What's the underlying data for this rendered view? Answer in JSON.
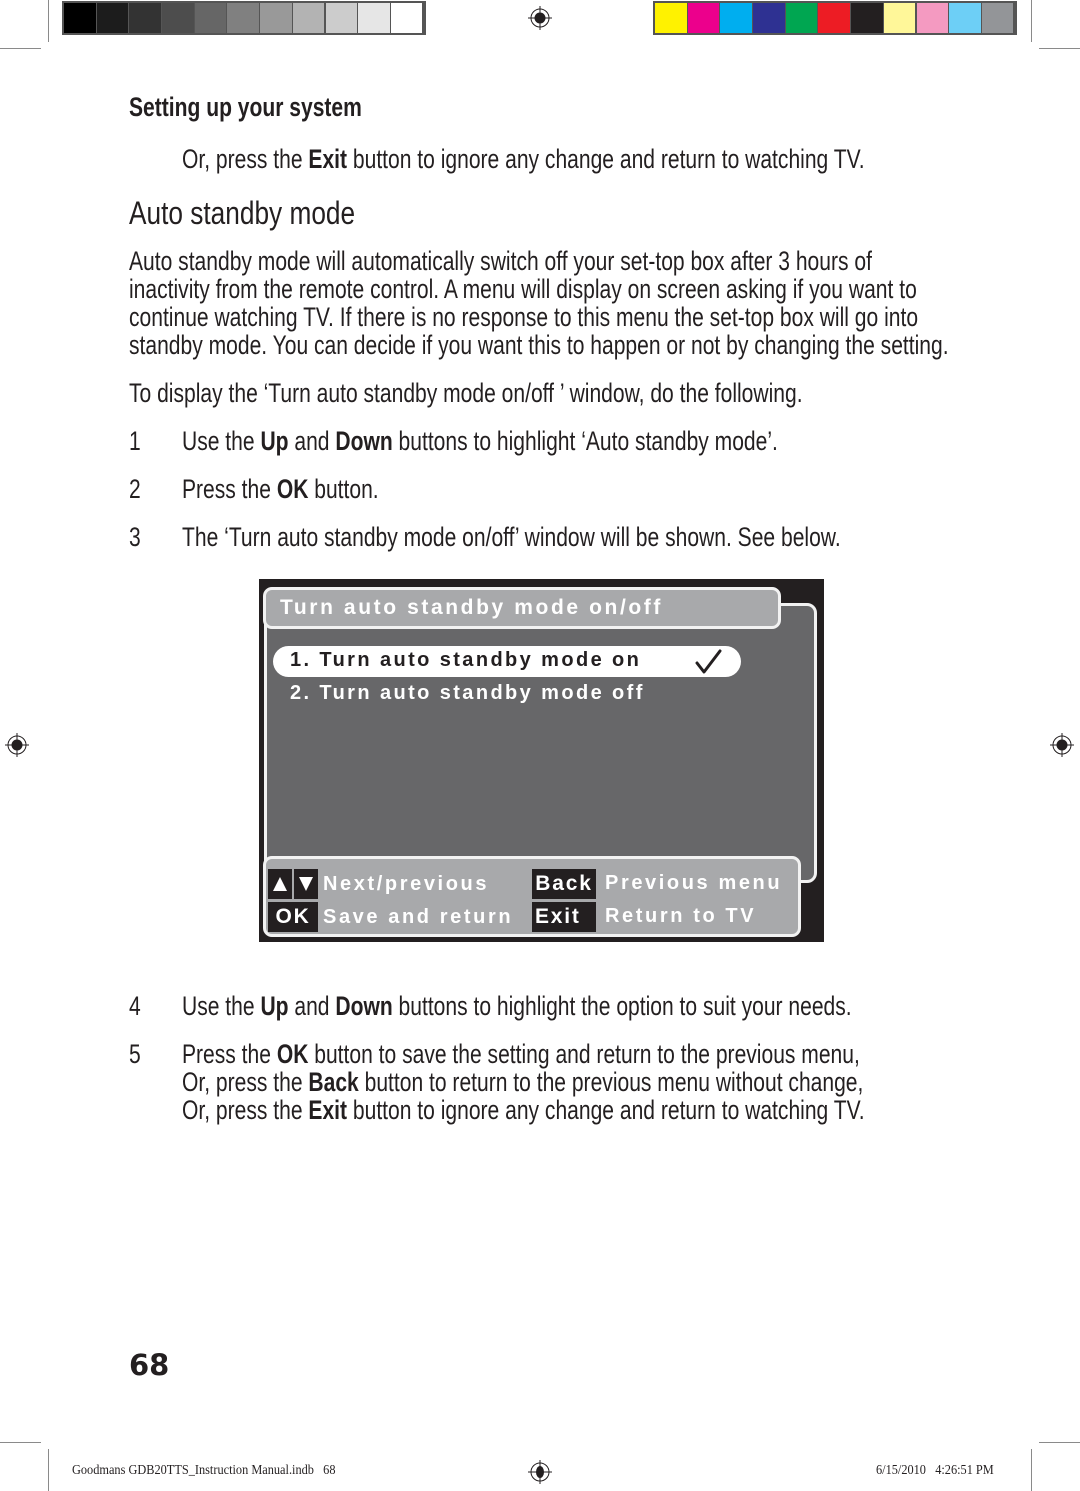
{
  "print_marks": {
    "gray_swatches": [
      "#000000",
      "#1c1c1c",
      "#333333",
      "#4d4d4d",
      "#666666",
      "#808080",
      "#999999",
      "#b3b3b3",
      "#cccccc",
      "#e6e6e6",
      "#ffffff"
    ],
    "color_swatches": [
      "#fff200",
      "#ec008c",
      "#00aeef",
      "#2e3192",
      "#00a651",
      "#ed1c24",
      "#231f20",
      "#fff799",
      "#f49ac1",
      "#6dcff6",
      "#939598"
    ]
  },
  "header": {
    "section_title": "Setting up your system"
  },
  "intro_line": {
    "pre": "Or, press the ",
    "bold": "Exit",
    "post": " button to ignore any change and return to watching TV."
  },
  "heading": "Auto standby mode",
  "paragraph_lines": [
    "Auto standby mode will automatically switch off your set-top box after 3 hours of",
    "inactivity from the remote control. A menu will display on screen asking if you want to",
    "continue watching TV. If there is no response to this menu the set-top box will go into",
    "standby mode. You can decide if you want this to happen or not by changing the setting."
  ],
  "lead_in": "To display the ‘Turn auto standby mode on/off ’ window, do the following.",
  "steps": [
    {
      "num": "1",
      "parts": [
        [
          "Use the ",
          false
        ],
        [
          "Up",
          true
        ],
        [
          " and ",
          false
        ],
        [
          "Down",
          true
        ],
        [
          " buttons to highlight ‘Auto standby mode’.",
          false
        ]
      ]
    },
    {
      "num": "2",
      "parts": [
        [
          "Press the ",
          false
        ],
        [
          "OK",
          true
        ],
        [
          " button.",
          false
        ]
      ]
    },
    {
      "num": "3",
      "parts": [
        [
          "The ‘Turn auto standby mode on/off’ window will be shown. See below.",
          false
        ]
      ]
    },
    {
      "num": "4",
      "parts": [
        [
          "Use the ",
          false
        ],
        [
          "Up",
          true
        ],
        [
          " and ",
          false
        ],
        [
          "Down",
          true
        ],
        [
          " buttons to highlight the option to suit your needs.",
          false
        ]
      ]
    }
  ],
  "step5": {
    "num": "5",
    "lines": [
      [
        [
          "Press the ",
          false
        ],
        [
          "OK",
          true
        ],
        [
          " button to save the setting and return to the previous menu,",
          false
        ]
      ],
      [
        [
          "Or, press the ",
          false
        ],
        [
          "Back",
          true
        ],
        [
          " button to return to the previous menu without change,",
          false
        ]
      ],
      [
        [
          "Or, press the ",
          false
        ],
        [
          "Exit",
          true
        ],
        [
          " button to ignore any change and return to watching TV.",
          false
        ]
      ]
    ]
  },
  "tv_screen": {
    "title": "Turn auto standby mode on/off",
    "options": [
      {
        "label": "1. Turn auto standby mode on",
        "selected": true,
        "checked": true
      },
      {
        "label": "2. Turn auto standby mode off",
        "selected": false,
        "checked": false
      }
    ],
    "footer": {
      "nav_label": "Next/previous",
      "ok_key": "OK",
      "ok_label": "Save and return",
      "back_key": "Back",
      "back_label": "Previous menu",
      "exit_key": "Exit",
      "exit_label": "Return to TV"
    }
  },
  "page_number": "68",
  "footer": {
    "file": "Goodmans GDB20TTS_Instruction Manual.indb   68",
    "timestamp": "6/15/2010   4:26:51 PM"
  }
}
